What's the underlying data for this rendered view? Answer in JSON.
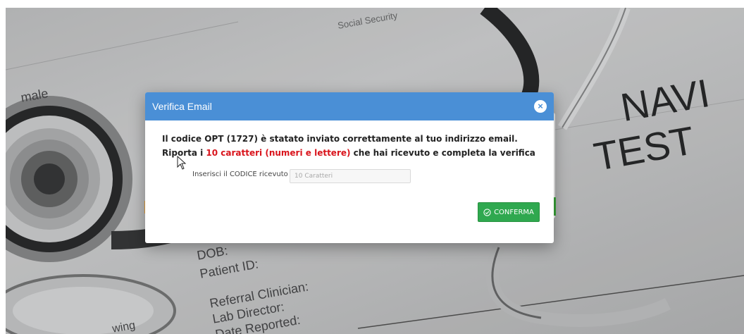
{
  "background": {
    "form_labels": [
      "male",
      "Social Security",
      "DOB:",
      "Patient ID:",
      "Referral Clinician:",
      "Lab Director:",
      "Date Reported:",
      "NAVI",
      "TEST",
      "wing"
    ]
  },
  "modal": {
    "title": "Verifica Email",
    "close_icon": "close-icon",
    "message_line1": "Il codice OPT (1727) è statato inviato correttamente al tuo indirizzo email.",
    "message_line2_prefix": "Riporta i ",
    "message_line2_highlight": "10 caratteri (numeri e lettere)",
    "message_line2_suffix": " che hai ricevuto e completa la verifica",
    "highlight_color": "#d9141c",
    "field_label": "Inserisci il CODICE ricevuto",
    "field_placeholder": "10 Caratteri",
    "field_value": "",
    "confirm_label": "CONFERMA",
    "confirm_icon": "check-circle-icon"
  },
  "colors": {
    "header": "#4a8fd6",
    "confirm": "#2fa84f"
  }
}
